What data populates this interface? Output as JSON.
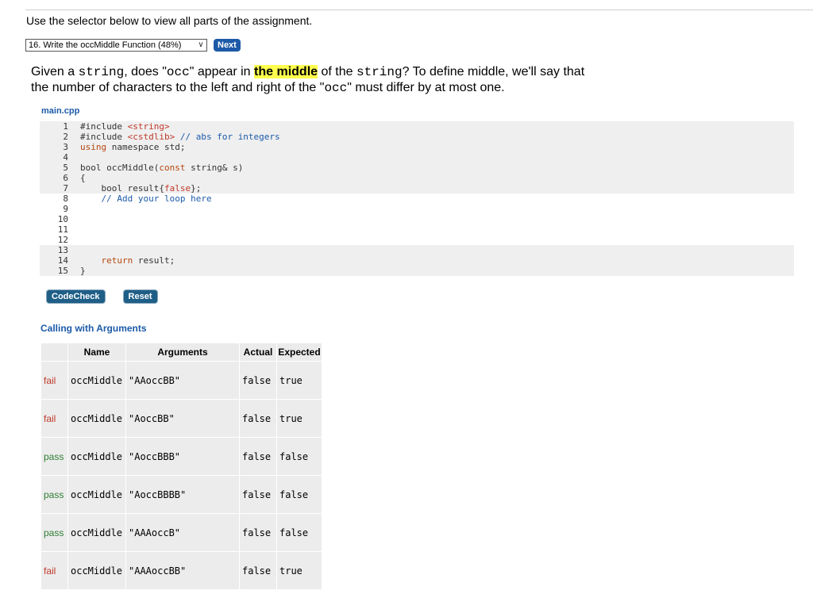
{
  "instructions": "Use the selector below to view all parts of the assignment.",
  "selector": {
    "selected": "16. Write the occMiddle Function (48%)"
  },
  "next_label": "Next",
  "question": {
    "p1": "Given a ",
    "c1": "string",
    "p2": ", does \"",
    "c2": "occ",
    "p3": "\" appear in ",
    "highlight": "the middle",
    "p4": " of the ",
    "c3": "string",
    "p5": "? To define middle, we'll say that the number of characters to the left and right of the \"",
    "c4": "occ",
    "p6": "\" must differ by at most one."
  },
  "filename": "main.cpp",
  "code": {
    "l1a": "#include ",
    "l1b": "<string>",
    "l2a": "#include ",
    "l2b": "<cstdlib>",
    "l2c": " // abs for integers",
    "l3a": "using",
    "l3b": " namespace std;",
    "l5a": "bool occMiddle(",
    "l5b": "const",
    "l5c": " string& s)",
    "l6": "{",
    "l7a": "    bool result{",
    "l7b": "false",
    "l7c": "};",
    "l8": "    // Add your loop here",
    "l14a": "    ",
    "l14b": "return",
    "l14c": " result;",
    "l15": "}"
  },
  "buttons": {
    "codecheck": "CodeCheck",
    "reset": "Reset"
  },
  "results_title": "Calling with Arguments",
  "table": {
    "headers": {
      "name": "Name",
      "arguments": "Arguments",
      "actual": "Actual",
      "expected": "Expected"
    },
    "rows": [
      {
        "status": "fail",
        "name": "occMiddle",
        "args": "\"AAoccBB\"",
        "actual": "false",
        "expected": "true"
      },
      {
        "status": "fail",
        "name": "occMiddle",
        "args": "\"AoccBB\"",
        "actual": "false",
        "expected": "true"
      },
      {
        "status": "pass",
        "name": "occMiddle",
        "args": "\"AoccBBB\"",
        "actual": "false",
        "expected": "false"
      },
      {
        "status": "pass",
        "name": "occMiddle",
        "args": "\"AoccBBBB\"",
        "actual": "false",
        "expected": "false"
      },
      {
        "status": "pass",
        "name": "occMiddle",
        "args": "\"AAAoccB\"",
        "actual": "false",
        "expected": "false"
      },
      {
        "status": "fail",
        "name": "occMiddle",
        "args": "\"AAAoccBB\"",
        "actual": "false",
        "expected": "true"
      }
    ]
  }
}
